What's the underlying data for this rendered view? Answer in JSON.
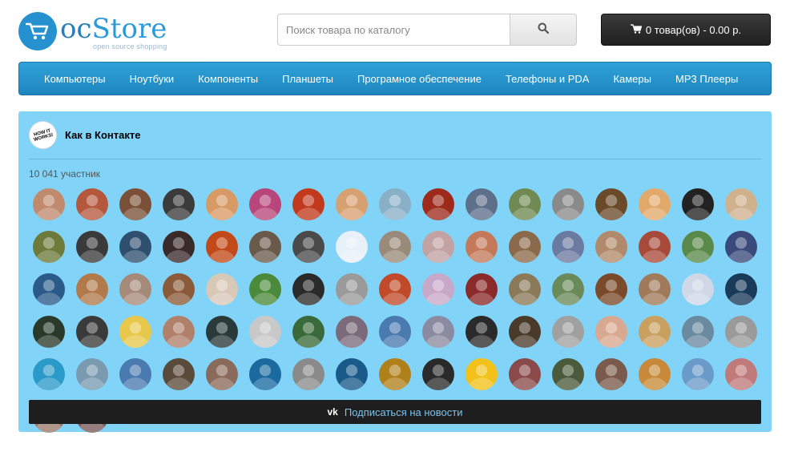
{
  "logo": {
    "oc": "oc",
    "store": "Store",
    "tagline": "open source shopping"
  },
  "search": {
    "placeholder": "Поиск товара по каталогу",
    "icon": "search-icon"
  },
  "cart": {
    "label": "0 товар(ов) - 0.00 р.",
    "icon": "cart-icon"
  },
  "menu": {
    "items": [
      {
        "label": "Компьютеры"
      },
      {
        "label": "Ноутбуки"
      },
      {
        "label": "Компоненты"
      },
      {
        "label": "Планшеты"
      },
      {
        "label": "Програмное обеспечение"
      },
      {
        "label": "Телефоны и PDA"
      },
      {
        "label": "Камеры"
      },
      {
        "label": "MP3 Плееры"
      }
    ]
  },
  "widget": {
    "group_logo_text": "HOW IT WORKS!",
    "title": "Как в Контакте",
    "members": "10 041 участник",
    "subscribe_icon": "vk-icon",
    "subscribe_label": "Подписаться на новости",
    "avatar_colors": [
      "#c08a6e",
      "#b5573d",
      "#7a5038",
      "#3b3b3b",
      "#d89a64",
      "#b8467a",
      "#c23a1e",
      "#d7a070",
      "#8ab0c8",
      "#9e2a1c",
      "#5e6f8a",
      "#6f8a52",
      "#8a8a8a",
      "#6b4a2a",
      "#e3a96a",
      "#222222",
      "#cfb18d",
      "#6d7a3a",
      "#3a3a3a",
      "#2f4f6f",
      "#3a2a2a",
      "#c24a1a",
      "#6a5a4a",
      "#4a4a4a",
      "#e8f0f8",
      "#9a8a7a",
      "#c2a2a2",
      "#c47a5a",
      "#8a6a4a",
      "#6a7aa0",
      "#b08a6a",
      "#a84a3a",
      "#5a8a4a",
      "#3a4a7a",
      "#2a5a8a",
      "#b07a4a",
      "#a58a7a",
      "#8a5a3a",
      "#d8c8b8",
      "#4a8a3a",
      "#2a2a2a",
      "#9a9a9a",
      "#c04a2a",
      "#c8a8c8",
      "#8a2a2a",
      "#8a7a5a",
      "#6a8a5a",
      "#7a4a2a",
      "#a07a5a",
      "#d0d8e8",
      "#1a3a5a",
      "#2a3a2a",
      "#3a3a3a",
      "#e8c84a",
      "#b0806a",
      "#2a3a3a",
      "#c8c8c8",
      "#3a6a3a",
      "#7a6a7a",
      "#4a7ab0",
      "#8a8aa0",
      "#2a2a2a",
      "#4a3a2a",
      "#a0a0a0",
      "#d8a890",
      "#caa060",
      "#6a8aa0",
      "#9a9a9a",
      "#2a9ac8",
      "#7a9ab0",
      "#4a7ab0",
      "#5a4a3a",
      "#8a6a5a",
      "#1a6aa0",
      "#8a8a8a",
      "#1a5a8a",
      "#b0801a",
      "#2a2a2a",
      "#f2c21a",
      "#8a4a4a",
      "#4a5a3a",
      "#7a5a4a",
      "#c88a3a",
      "#6a9ac8",
      "#c07a7a",
      "#9a7a6a",
      "#7a5a5a"
    ]
  }
}
